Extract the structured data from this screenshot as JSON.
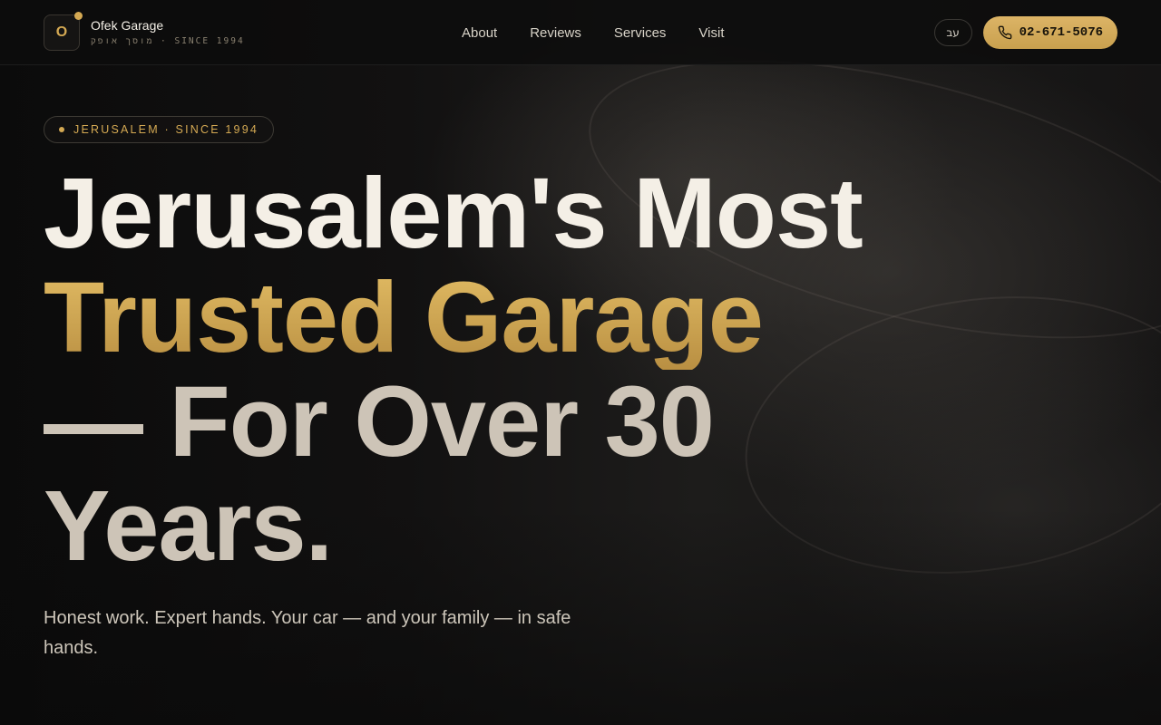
{
  "header": {
    "logo_letter": "O",
    "brand_name": "Ofek Garage",
    "brand_sub": "מוסך אופק · SINCE 1994",
    "nav": [
      {
        "label": "About"
      },
      {
        "label": "Reviews"
      },
      {
        "label": "Services"
      },
      {
        "label": "Visit"
      }
    ],
    "lang_label": "עב",
    "phone": "02-671-5076",
    "phone_icon": "phone-icon"
  },
  "hero": {
    "pill": "JERUSALEM · SINCE 1994",
    "headline": {
      "line1": "Jerusalem's Most",
      "line2": "Trusted Garage",
      "line3": "— For Over 30",
      "line4": "Years."
    },
    "subtitle": "Honest work. Expert hands. Your car — and your family — in safe hands."
  },
  "colors": {
    "accent": "#d4a953",
    "background": "#0b0b0b",
    "headline_primary": "#f4efe6",
    "headline_muted": "#cdc4b7"
  }
}
